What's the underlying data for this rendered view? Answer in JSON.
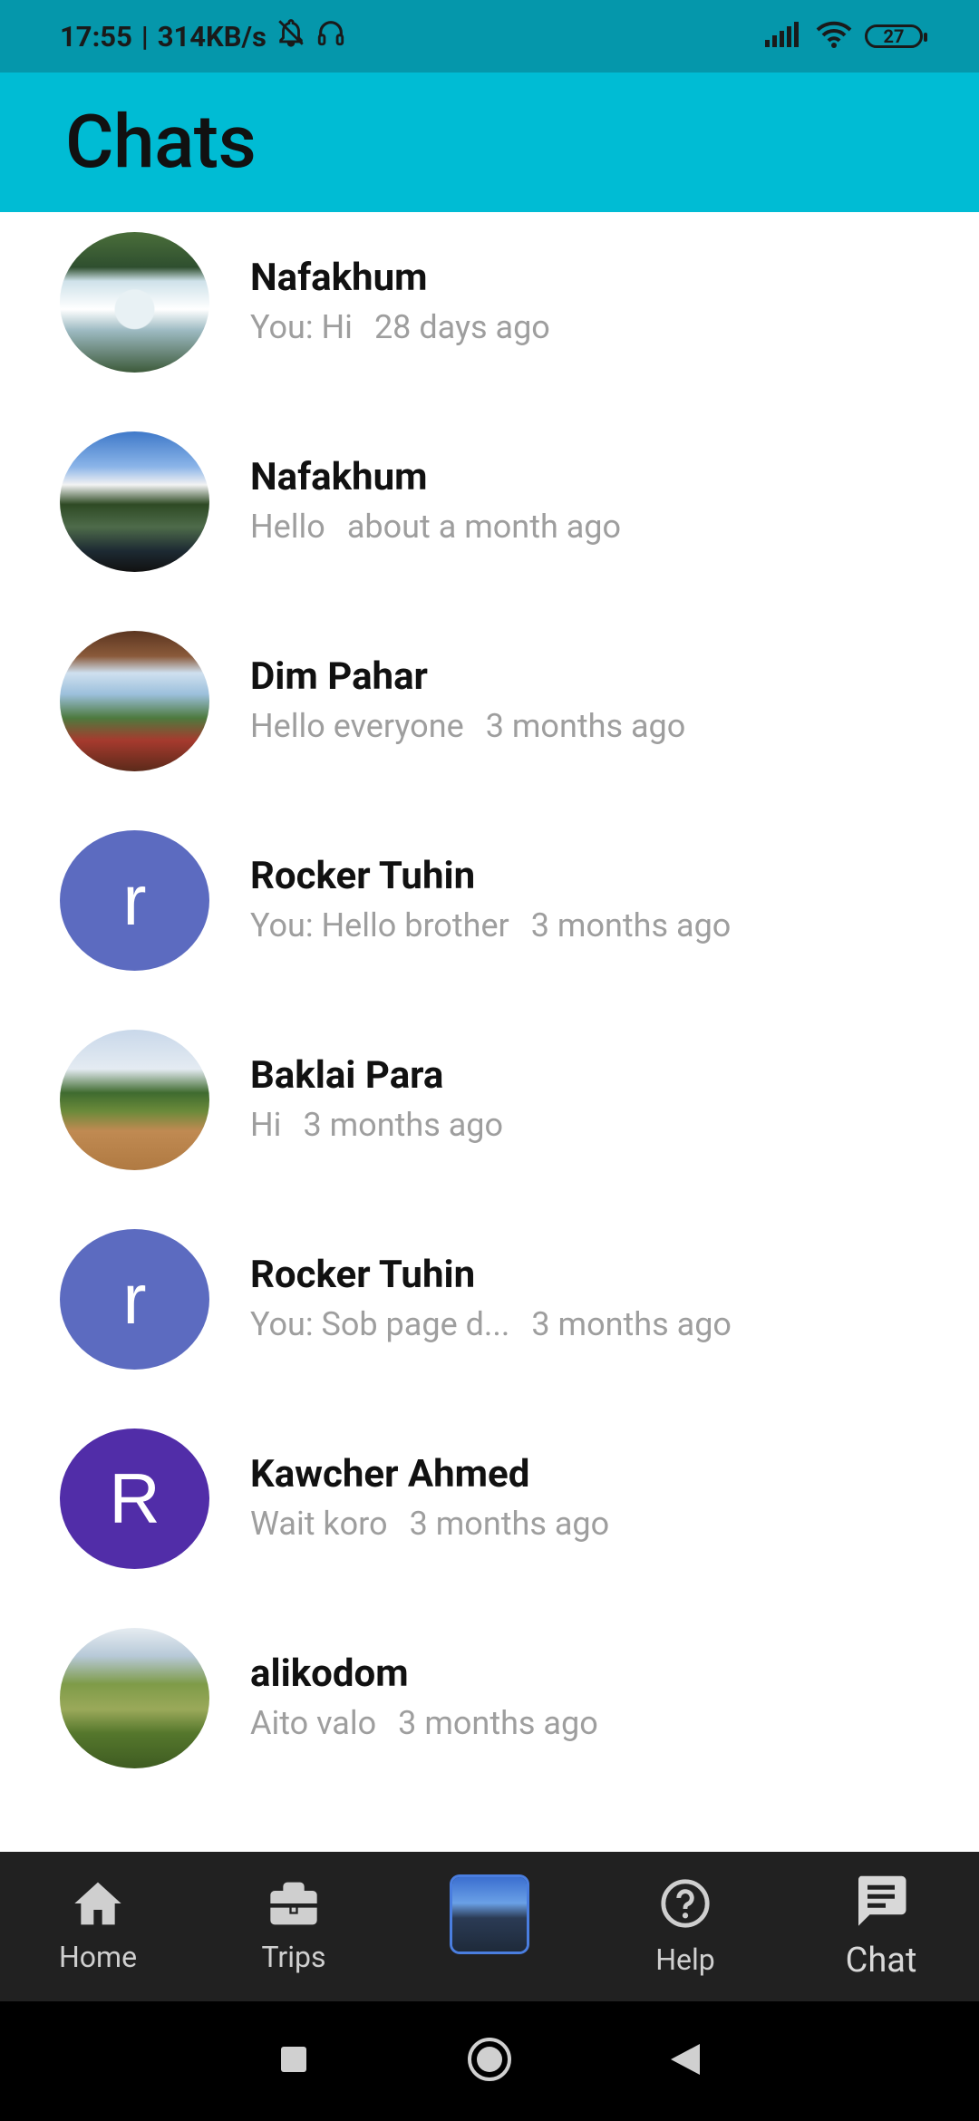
{
  "status_bar": {
    "time": "17:55",
    "speed": "314KB/s",
    "battery": "27",
    "icons": [
      "bell-off-icon",
      "headset-icon",
      "signal-icon",
      "wifi-icon",
      "battery-icon"
    ]
  },
  "appbar": {
    "title": "Chats"
  },
  "chats": [
    {
      "name": "Nafakhum",
      "message": "You: Hi",
      "time": "28 days ago",
      "avatar_type": "photo",
      "avatar_photo": "waterfall"
    },
    {
      "name": "Nafakhum",
      "message": "Hello",
      "time": "about a month ago",
      "avatar_type": "photo",
      "avatar_photo": "lake"
    },
    {
      "name": "Dim Pahar",
      "message": "Hello everyone",
      "time": "3 months ago",
      "avatar_type": "photo",
      "avatar_photo": "hut"
    },
    {
      "name": "Rocker Tuhin",
      "message": "You: Hello brother",
      "time": "3 months ago",
      "avatar_type": "letter",
      "avatar_letter": "r",
      "avatar_color": "#5c6bc0"
    },
    {
      "name": "Baklai Para",
      "message": "Hi",
      "time": "3 months ago",
      "avatar_type": "photo",
      "avatar_photo": "field"
    },
    {
      "name": "Rocker Tuhin",
      "message": "You: Sob page d...",
      "time": "3 months ago",
      "avatar_type": "letter",
      "avatar_letter": "r",
      "avatar_color": "#5c6bc0"
    },
    {
      "name": "Kawcher Ahmed",
      "message": "Wait koro",
      "time": "3 months ago",
      "avatar_type": "letter",
      "avatar_letter": "R",
      "avatar_color": "#512da8"
    },
    {
      "name": "alikodom",
      "message": "Aito valo",
      "time": "3 months ago",
      "avatar_type": "photo",
      "avatar_photo": "forest"
    }
  ],
  "bottom_nav": {
    "home": "Home",
    "trips": "Trips",
    "help": "Help",
    "chat": "Chat",
    "active": "chat"
  },
  "colors": {
    "status_bar": "#0597ab",
    "appbar": "#00bcd4",
    "bottom_nav": "#212121",
    "avatar_indigo": "#5c6bc0",
    "avatar_purple": "#512da8"
  }
}
